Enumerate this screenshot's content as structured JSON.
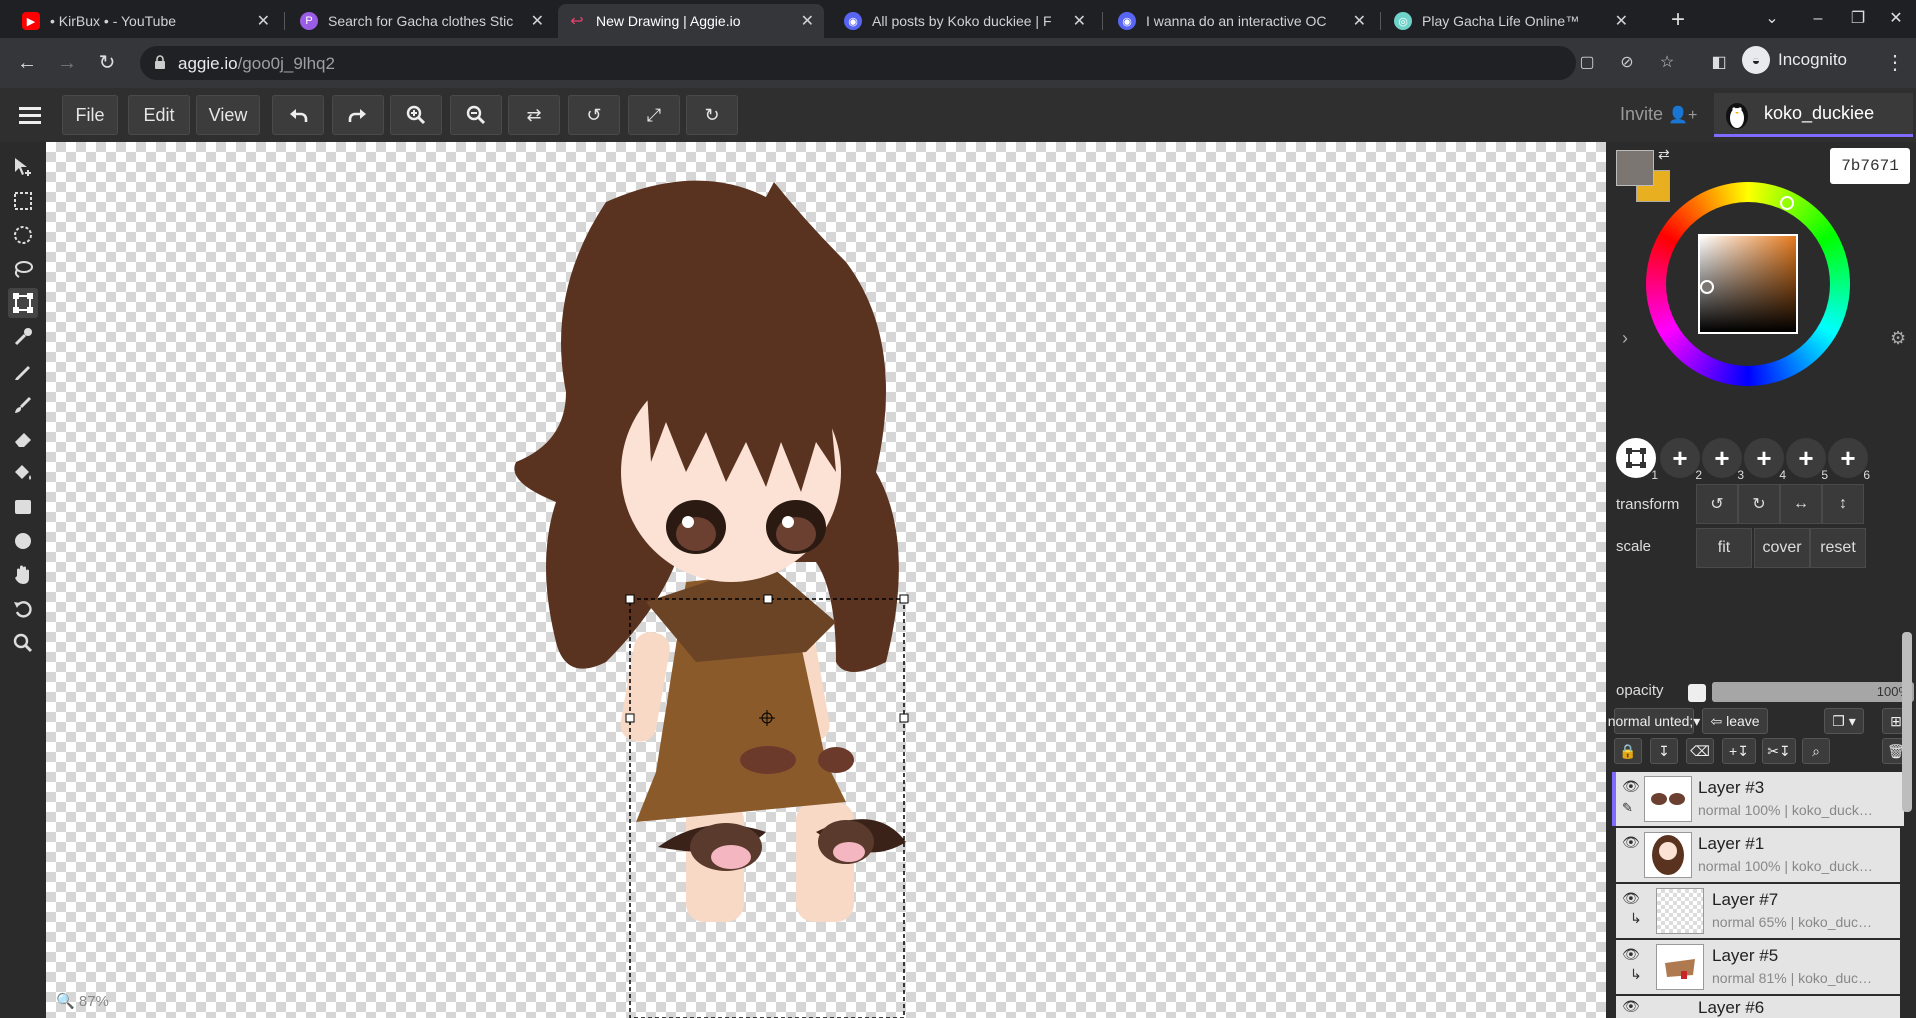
{
  "browser": {
    "tabs": [
      {
        "title": "• KirBux • - YouTube",
        "favicon": "youtube-icon",
        "color": "#ff0000"
      },
      {
        "title": "Search for Gacha clothes Stic",
        "favicon": "picsart-icon",
        "color": "#9b5de5"
      },
      {
        "title": "New Drawing | Aggie.io",
        "favicon": "aggie-icon",
        "color": "#e8406c"
      },
      {
        "title": "All posts by Koko duckiee | F",
        "favicon": "discord-icon",
        "color": "#5865f2"
      },
      {
        "title": "I wanna do an interactive OC",
        "favicon": "discord-icon",
        "color": "#5865f2"
      },
      {
        "title": "Play Gacha Life Online™",
        "favicon": "gacha-icon",
        "color": "#6fd3c9"
      }
    ],
    "active_tab": 2,
    "url_host": "aggie.io",
    "url_path": "/goo0j_9lhq2",
    "incognito_label": "Incognito"
  },
  "app": {
    "menu": {
      "file": "File",
      "edit": "Edit",
      "view": "View"
    },
    "invite_label": "Invite",
    "username": "koko_duckiee",
    "zoom": "87%",
    "accent": "#7f6bff"
  },
  "color": {
    "hex": "7b7671",
    "primary": "#7b7671",
    "secondary": "#e8b020"
  },
  "tool_slots": [
    "1",
    "2",
    "3",
    "4",
    "5",
    "6"
  ],
  "transform": {
    "label": "transform",
    "scale_label": "scale",
    "scale_buttons": {
      "fit": "fit",
      "cover": "cover",
      "reset": "reset"
    }
  },
  "layers_panel": {
    "opacity_label": "opacity",
    "opacity_value": "100%",
    "opacity": 1.0,
    "blend_mode": "normal",
    "leave_label": "leave",
    "layers": [
      {
        "name": "Layer #3",
        "meta": "normal 100% | koko_duck…",
        "active": true
      },
      {
        "name": "Layer #1",
        "meta": "normal 100% | koko_duck…",
        "active": false
      },
      {
        "name": "Layer #7",
        "meta": "normal 65% | koko_duc…",
        "active": false,
        "clipped": true
      },
      {
        "name": "Layer #5",
        "meta": "normal 81% | koko_duc…",
        "active": false,
        "clipped": true
      },
      {
        "name": "Layer #6",
        "meta": "",
        "active": false
      }
    ]
  }
}
